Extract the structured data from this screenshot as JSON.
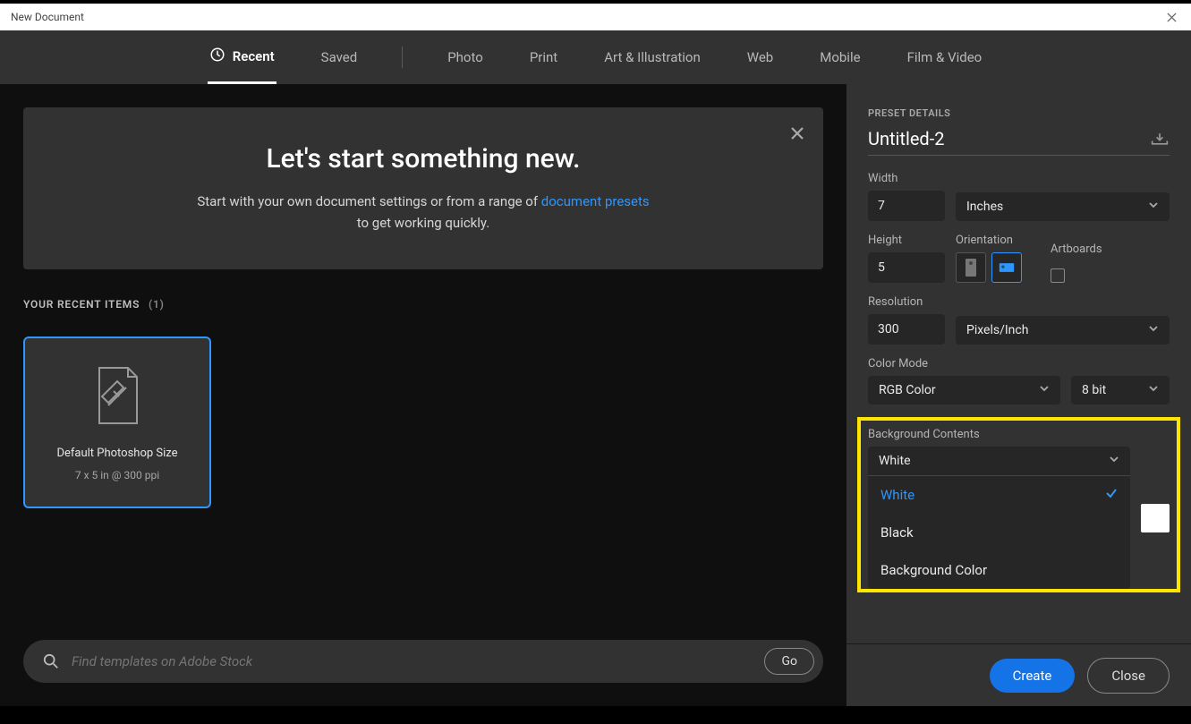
{
  "window": {
    "title": "New Document"
  },
  "tabs": {
    "recent": "Recent",
    "saved": "Saved",
    "photo": "Photo",
    "print": "Print",
    "art": "Art & Illustration",
    "web": "Web",
    "mobile": "Mobile",
    "film": "Film & Video"
  },
  "banner": {
    "heading": "Let's start something new.",
    "line1_pre": "Start with your own document settings or from a range of ",
    "line1_link": "document presets",
    "line2": "to get working quickly."
  },
  "recents": {
    "label": "YOUR RECENT ITEMS",
    "count": "(1)",
    "items": [
      {
        "name": "Default Photoshop Size",
        "dims": "7 x 5 in @ 300 ppi"
      }
    ]
  },
  "search": {
    "placeholder": "Find templates on Adobe Stock",
    "go": "Go"
  },
  "details": {
    "section_label": "PRESET DETAILS",
    "document_name": "Untitled-2",
    "width_label": "Width",
    "width_value": "7",
    "units": "Inches",
    "height_label": "Height",
    "height_value": "5",
    "orientation_label": "Orientation",
    "artboards_label": "Artboards",
    "resolution_label": "Resolution",
    "resolution_value": "300",
    "resolution_units": "Pixels/Inch",
    "color_mode_label": "Color Mode",
    "color_mode": "RGB Color",
    "color_depth": "8 bit",
    "bgcontents_label": "Background Contents",
    "bgcontents_value": "White",
    "bg_options": {
      "white": "White",
      "black": "Black",
      "bgcolor": "Background Color"
    }
  },
  "footer": {
    "create": "Create",
    "close": "Close"
  }
}
